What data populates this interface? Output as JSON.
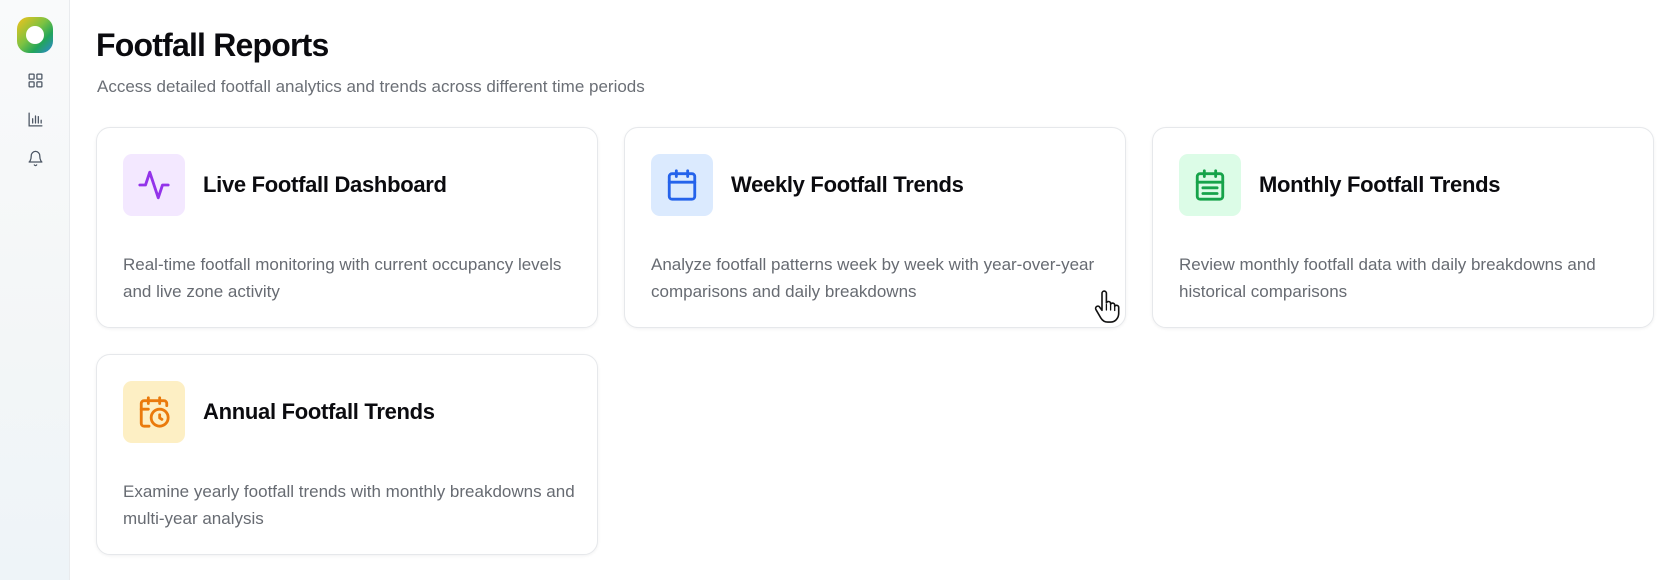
{
  "header": {
    "title": "Footfall Reports",
    "subtitle": "Access detailed footfall analytics and trends across different time periods"
  },
  "sidebar": {
    "items": [
      {
        "icon": "grid-icon"
      },
      {
        "icon": "bar-chart-icon"
      },
      {
        "icon": "bell-icon"
      }
    ]
  },
  "cards": [
    {
      "title": "Live Footfall Dashboard",
      "description": "Real-time footfall monitoring with current occupancy levels and live zone activity",
      "icon": "activity-icon",
      "icon_color": "#9333ea",
      "icon_bg": "#f3e8ff"
    },
    {
      "title": "Weekly Footfall Trends",
      "description": "Analyze footfall patterns week by week with year-over-year comparisons and daily breakdowns",
      "icon": "calendar-icon",
      "icon_color": "#2563eb",
      "icon_bg": "#dbeafe"
    },
    {
      "title": "Monthly Footfall Trends",
      "description": "Review monthly footfall data with daily breakdowns and historical comparisons",
      "icon": "calendar-list-icon",
      "icon_color": "#16a34a",
      "icon_bg": "#dcfce7"
    },
    {
      "title": "Annual Footfall Trends",
      "description": "Examine yearly footfall trends with monthly breakdowns and multi-year analysis",
      "icon": "calendar-clock-icon",
      "icon_color": "#ea7a0c",
      "icon_bg": "#fdefc4"
    }
  ]
}
